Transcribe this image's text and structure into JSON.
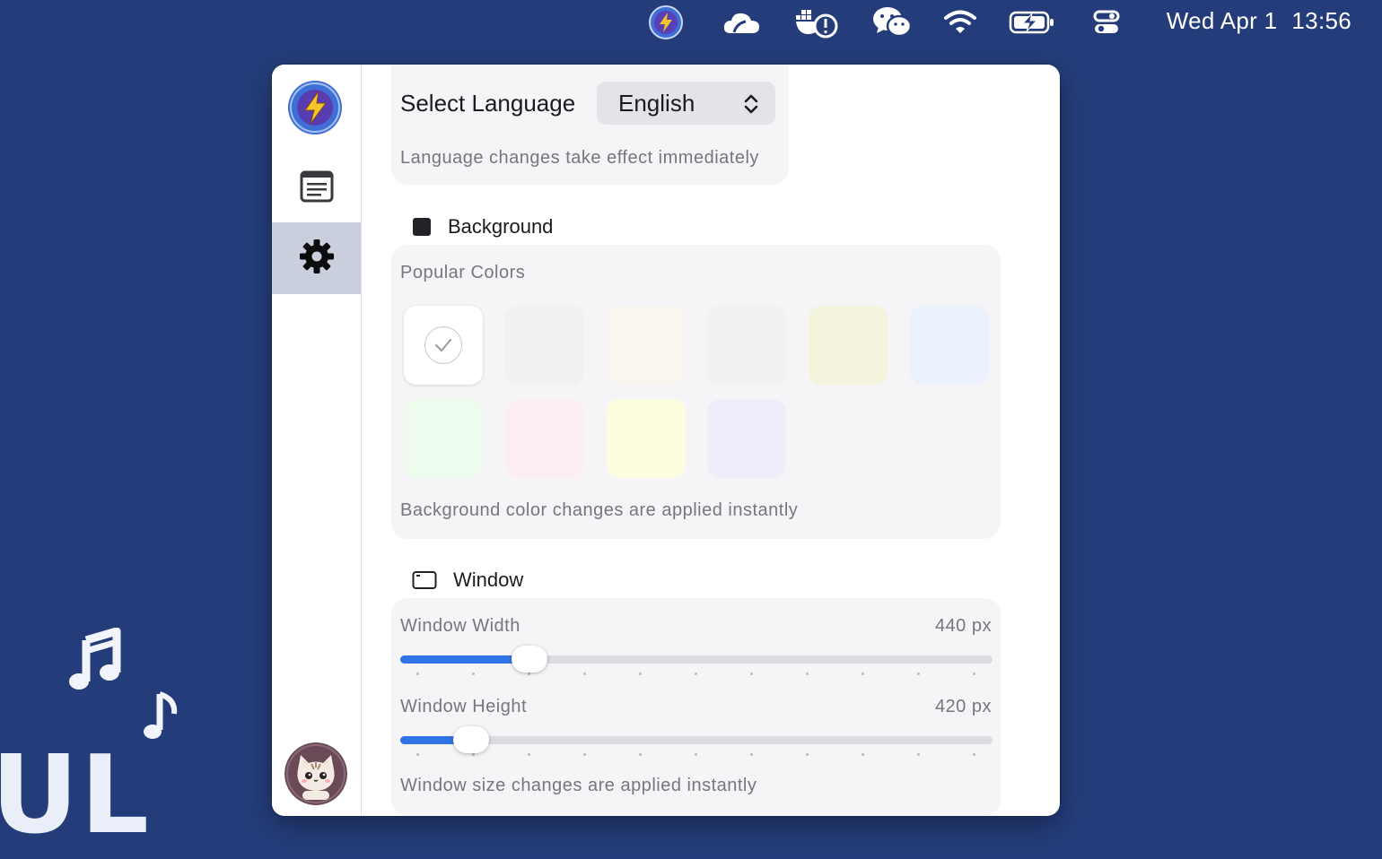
{
  "menubar": {
    "icons": [
      "app-bolt-icon",
      "cloud-icon",
      "docker-alert-icon",
      "wechat-icon",
      "wifi-icon",
      "battery-charging-icon",
      "control-center-icon"
    ],
    "date": "Wed Apr 1",
    "time": "13:56"
  },
  "sidebar": {
    "items": [
      {
        "name": "logo",
        "icon": "bolt-logo-icon"
      },
      {
        "name": "notes",
        "icon": "document-list-icon"
      },
      {
        "name": "settings",
        "icon": "gear-icon",
        "active": true
      }
    ],
    "avatar": "cat-avatar"
  },
  "language": {
    "label": "Select Language",
    "selected": "English",
    "note": "Language changes take effect immediately"
  },
  "background": {
    "title": "Background",
    "popular_label": "Popular Colors",
    "swatches": [
      "#ffffff",
      "#eff1ee",
      "#f8f6ef",
      "#f1f1f1",
      "#f3f3dc",
      "#ebf0fd",
      "#edfcec",
      "#fdeef1",
      "#fdfde0",
      "#eeeefa"
    ],
    "selected_index": 0,
    "note": "Background color changes are applied instantly"
  },
  "window": {
    "title": "Window",
    "width_label": "Window Width",
    "width_value": "440 px",
    "width_fraction": 0.218,
    "height_label": "Window Height",
    "height_value": "420 px",
    "height_fraction": 0.12,
    "note": "Window size changes are applied instantly"
  },
  "colors": {
    "desktop": "#243d7a",
    "accent": "#2f73e6",
    "sidebar_active": "#c9cfdc"
  }
}
